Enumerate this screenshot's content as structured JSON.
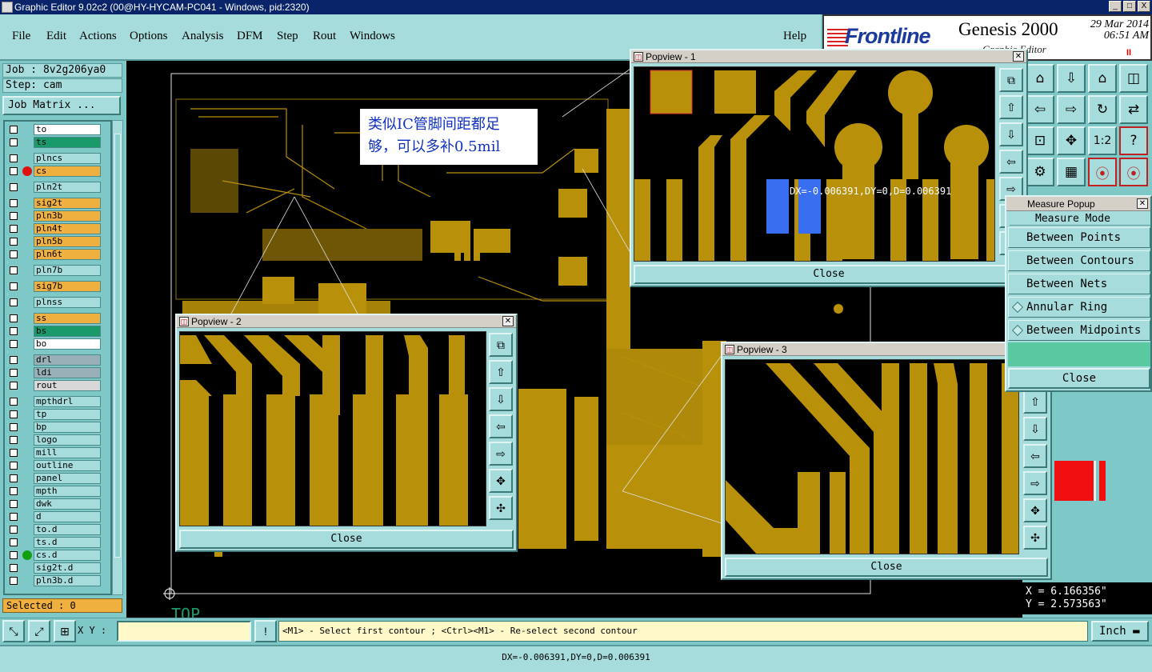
{
  "window": {
    "title": "Graphic Editor 9.02c2 (00@HY-HYCAM-PC041 - Windows, pid:2320)",
    "btn_min": "_",
    "btn_max": "□",
    "btn_close": "X"
  },
  "menu": [
    "File",
    "Edit",
    "Actions",
    "Options",
    "Analysis",
    "DFM",
    "Step",
    "Rout",
    "Windows"
  ],
  "help": "Help",
  "brand": {
    "logo": "Frontline",
    "product": "Genesis 2000",
    "date": "29 Mar 2014",
    "time": "06:51 AM",
    "subtitle": "Graphic Editor",
    "flag": "II"
  },
  "job": {
    "job": "Job : 8v2g206ya0",
    "step": "Step: cam",
    "matrix_button": "Job Matrix ..."
  },
  "layers": [
    {
      "name": "to",
      "color": "#ffffff"
    },
    {
      "name": "ts",
      "color": "#1a9a6a"
    },
    {
      "name": "plncs",
      "color": "#a7dcdc"
    },
    {
      "name": "cs",
      "color": "#f0b040"
    },
    {
      "name": "pln2t",
      "color": "#a7dcdc"
    },
    {
      "name": "sig2t",
      "color": "#f0b040"
    },
    {
      "name": "pln3b",
      "color": "#f0b040"
    },
    {
      "name": "pln4t",
      "color": "#f0b040"
    },
    {
      "name": "pln5b",
      "color": "#f0b040"
    },
    {
      "name": "pln6t",
      "color": "#f0b040"
    },
    {
      "name": "pln7b",
      "color": "#a7dcdc"
    },
    {
      "name": "sig7b",
      "color": "#f0b040"
    },
    {
      "name": "plnss",
      "color": "#a7dcdc"
    },
    {
      "name": "ss",
      "color": "#f0b040"
    },
    {
      "name": "bs",
      "color": "#1a9a6a"
    },
    {
      "name": "bo",
      "color": "#ffffff"
    },
    {
      "name": "drl",
      "color": "#9ab0b8"
    },
    {
      "name": "ldi",
      "color": "#9ab0b8"
    },
    {
      "name": "rout",
      "color": "#d8d8d8"
    },
    {
      "name": "mpthdrl",
      "color": "#a7dcdc"
    },
    {
      "name": "tp",
      "color": "#a7dcdc"
    },
    {
      "name": "bp",
      "color": "#a7dcdc"
    },
    {
      "name": "logo",
      "color": "#a7dcdc"
    },
    {
      "name": "mill",
      "color": "#a7dcdc"
    },
    {
      "name": "outline",
      "color": "#a7dcdc"
    },
    {
      "name": "panel",
      "color": "#a7dcdc"
    },
    {
      "name": "mpth",
      "color": "#a7dcdc"
    },
    {
      "name": "dwk",
      "color": "#a7dcdc"
    },
    {
      "name": "d",
      "color": "#a7dcdc"
    },
    {
      "name": "to.d",
      "color": "#a7dcdc"
    },
    {
      "name": "ts.d",
      "color": "#a7dcdc"
    },
    {
      "name": "cs.d",
      "color": "#a7dcdc"
    },
    {
      "name": "sig2t.d",
      "color": "#a7dcdc"
    },
    {
      "name": "pln3b.d",
      "color": "#a7dcdc"
    }
  ],
  "selected": "Selected : 0",
  "annotation": {
    "line1": "类似IC管脚间距都足",
    "line2": "够，可以多补0.5mil"
  },
  "board_label": "TOP",
  "popviews": [
    {
      "title": "Popview - 1",
      "close": "Close",
      "measure": "DX=-0.006391,DY=0,D=0.006391"
    },
    {
      "title": "Popview - 2",
      "close": "Close"
    },
    {
      "title": "Popview - 3",
      "close": "Close"
    }
  ],
  "measure_popup": {
    "title": "Measure Popup",
    "mode": "Measure Mode",
    "options": [
      "Between Points",
      "Between Contours",
      "Between Nets",
      "Annular Ring",
      "Between Midpoints"
    ],
    "close": "Close"
  },
  "toolbox": {
    "zoom_ratio": "1:2"
  },
  "coords": {
    "x": "X = 6.166356\"",
    "y": "Y = 2.573563\""
  },
  "bottom": {
    "xy_label": "X Y :",
    "xy_value": "",
    "message": "<M1> - Select first contour ; <Ctrl><M1> - Re-select second contour",
    "units": "Inch"
  },
  "status": "DX=-0.006391,DY=0,D=0.006391",
  "colors": {
    "copper": "#b8900a",
    "highlight": "#3a6ef0",
    "panel": "#a7dcdc",
    "titlebar": "#0a246a"
  }
}
